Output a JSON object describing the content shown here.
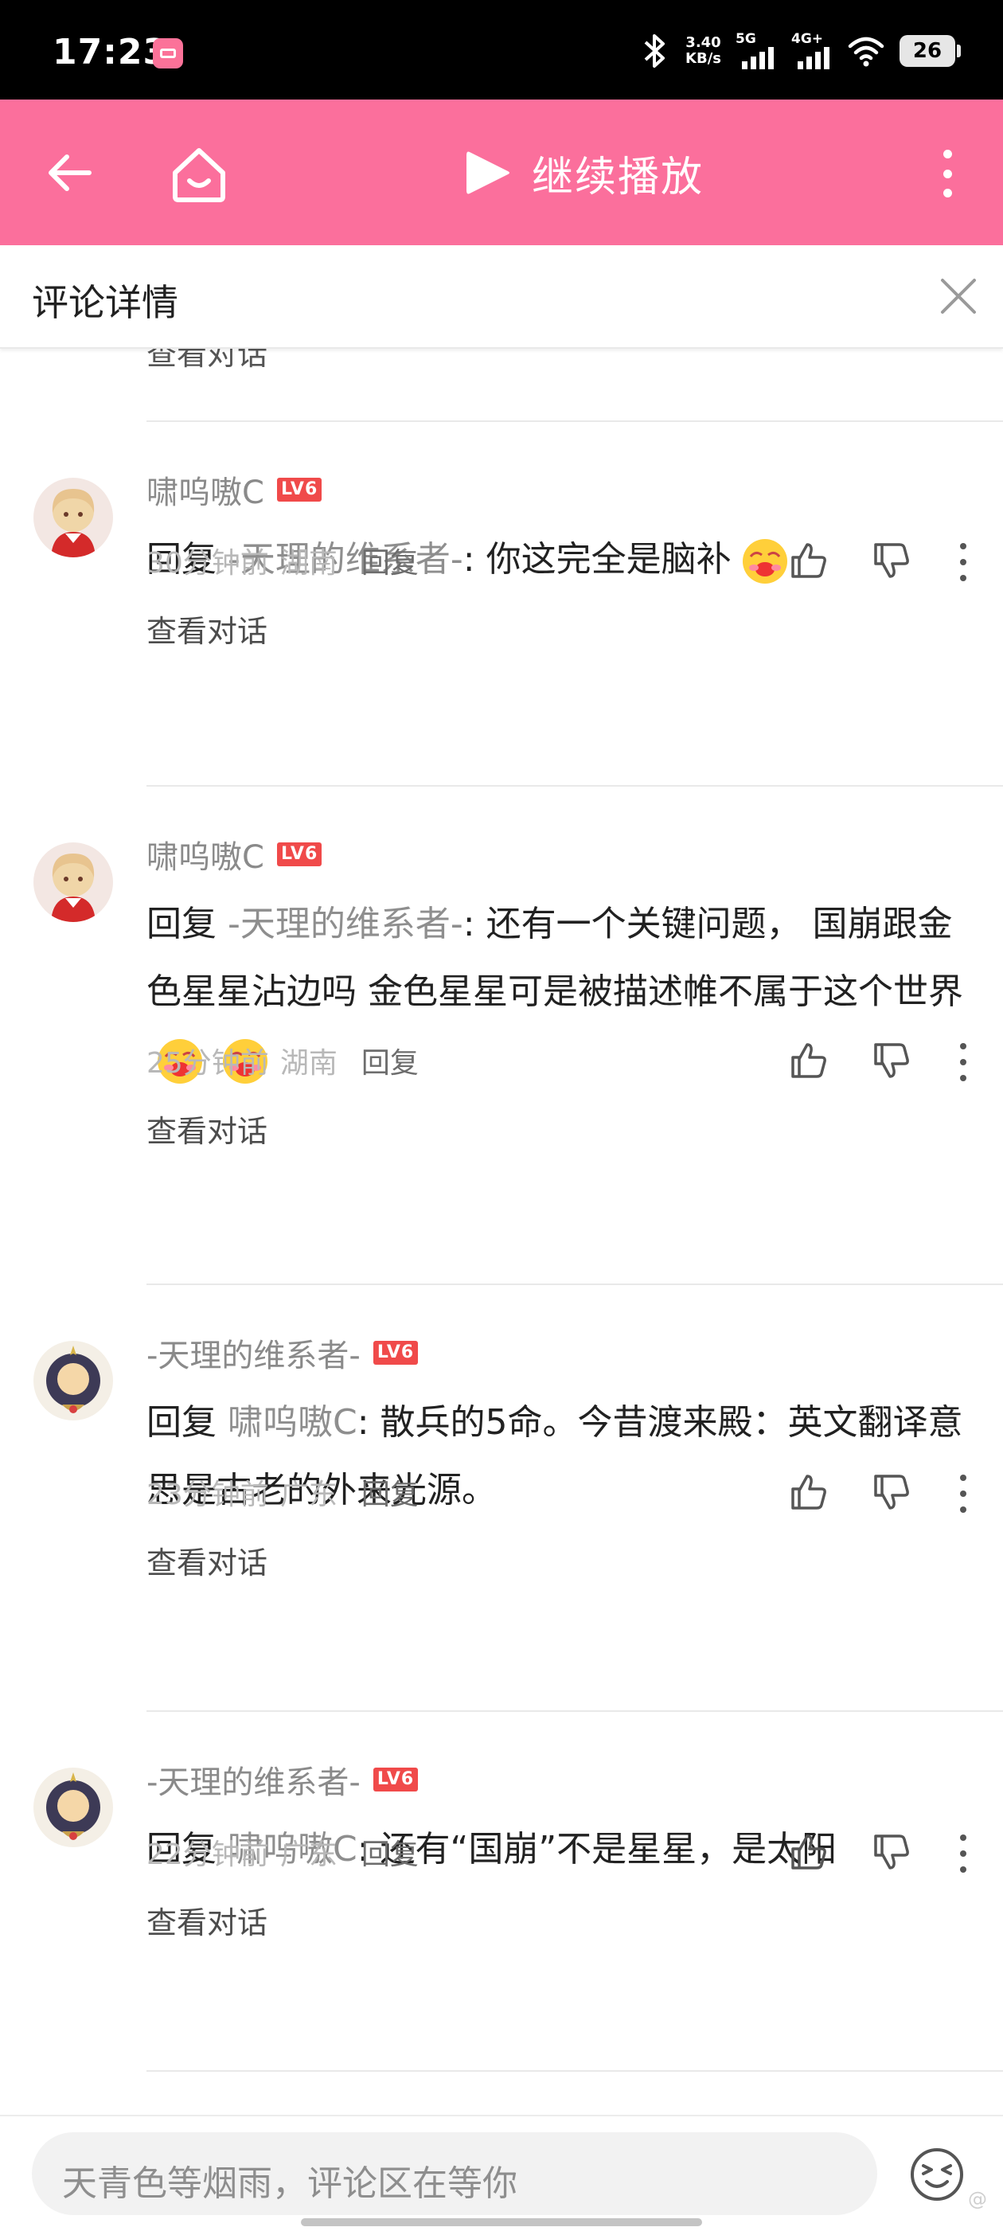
{
  "status_bar": {
    "time": "17:23",
    "net_speed_value": "3.40",
    "net_speed_unit": "KB/s",
    "sim1_label": "5G",
    "sim2_label": "4G+",
    "battery": "26",
    "icons": [
      "app-notification-icon",
      "bluetooth-icon",
      "signal-icon",
      "wifi-icon",
      "battery-icon"
    ]
  },
  "toolbar": {
    "color": "#fb6f9c",
    "continue_label": "继续播放",
    "icons": [
      "back-arrow-icon",
      "home-icon",
      "play-icon",
      "more-vertical-icon"
    ]
  },
  "panel": {
    "title": "评论详情",
    "close_icon": "close-icon",
    "partial_link": "查看对话"
  },
  "comments": [
    {
      "user": "啸呜嗷C",
      "level": "LV6",
      "reply_prefix": "回复 ",
      "reply_to": "-天理的维系者-",
      "text": ": 你这完全是脑补",
      "emojis": 1,
      "time": "30分钟前",
      "region": "湖南",
      "reply_label": "回复",
      "view_conversation": "查看对话"
    },
    {
      "user": "啸呜嗷C",
      "level": "LV6",
      "reply_prefix": "回复 ",
      "reply_to": "-天理的维系者-",
      "text": ": 还有一个关键问题， 国崩跟金色星星沾边吗  金色星星可是被描述帷不属于这个世界",
      "emojis": 2,
      "time": "25分钟前",
      "region": "湖南",
      "reply_label": "回复",
      "view_conversation": "查看对话"
    },
    {
      "user": "-天理的维系者-",
      "level": "LV6",
      "reply_prefix": "回复 ",
      "reply_to": "啸呜嗷C",
      "text": ": 散兵的5命。今昔渡来殿：英文翻译意思是古老的外来光源。",
      "emojis": 0,
      "time": "23分钟前",
      "region": "广东",
      "reply_label": "回复",
      "view_conversation": "查看对话"
    },
    {
      "user": "-天理的维系者-",
      "level": "LV6",
      "reply_prefix": "回复 ",
      "reply_to": "啸呜嗷C",
      "text": ": 还有“国崩”不是星星，是太阳",
      "emojis": 0,
      "time": "22分钟前",
      "region": "广东",
      "reply_label": "回复",
      "view_conversation": "查看对话"
    }
  ],
  "input_bar": {
    "placeholder": "天青色等烟雨，评论区在等你",
    "emoji_button_icon": "emoji-face-icon"
  },
  "watermark": "@"
}
